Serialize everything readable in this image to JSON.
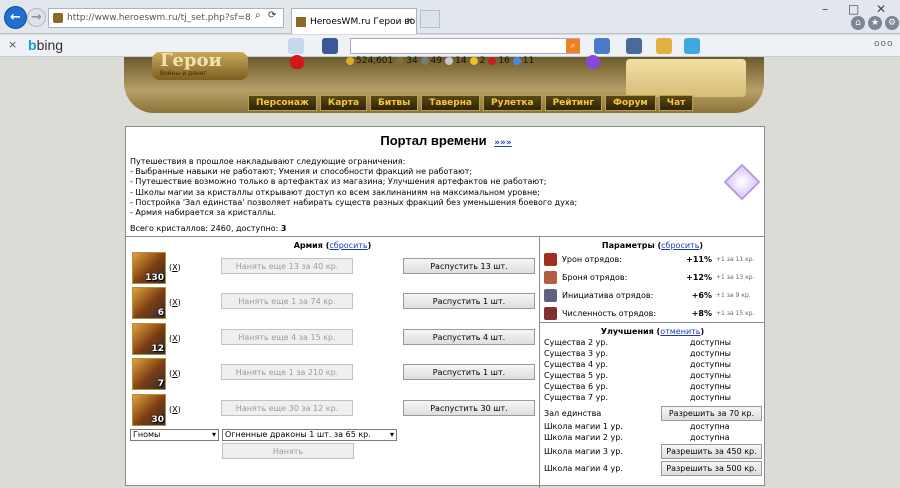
{
  "browser": {
    "url": "http://www.heroeswm.ru/tj_set.php?sf=8",
    "tab_title": "HeroesWM.ru Герои войн...",
    "search_engine": "bing",
    "back_glyph": "←",
    "forward_glyph": "→",
    "close_glyph": "×"
  },
  "resources": [
    {
      "value": "524,601",
      "color": "#e0b020"
    },
    {
      "value": "34",
      "color": "#8a6a3a"
    },
    {
      "value": "49",
      "color": "#7a7a7a"
    },
    {
      "value": "14",
      "color": "#c8c8c8"
    },
    {
      "value": "2",
      "color": "#e8c020"
    },
    {
      "value": "16",
      "color": "#c82020"
    },
    {
      "value": "11",
      "color": "#4a8ae0"
    }
  ],
  "header": {
    "logo": "Герои",
    "logo_sub": "Войны и денег"
  },
  "menu": [
    "Персонаж",
    "Карта",
    "Битвы",
    "Таверна",
    "Рулетка",
    "Рейтинг",
    "Форум",
    "Чат"
  ],
  "portal": {
    "title": "Портал времени",
    "more_link": "»»»",
    "restrictions": [
      "Путешествия в прошлое накладывают следующие ограничения:",
      "- Выбранные навыки не работают; Умения и способности фракций не работают;",
      "- Путешествие возможно только в артефактах из магазина; Улучшения артефактов не работают;",
      "- Школы магии за кристаллы открывают доступ ко всем заклинаниям на максимальном уровне;",
      "- Постройка 'Зал единства' позволяет набирать существ разных фракций без уменьшения боевого духа;",
      "- Армия набирается за кристаллы."
    ],
    "crystals_label": "Всего кристаллов: 2460, доступно:",
    "crystals_available": "3"
  },
  "army": {
    "title": "Армия",
    "reset": "сбросить",
    "remove_label": "X",
    "units": [
      {
        "count": "130",
        "hire": "Нанять еще 13 за 40 кр.",
        "dismiss": "Распустить 13 шт."
      },
      {
        "count": "6",
        "hire": "Нанять еще 1 за 74 кр.",
        "dismiss": "Распустить 1 шт."
      },
      {
        "count": "12",
        "hire": "Нанять еще 4 за 15 кр.",
        "dismiss": "Распустить 4 шт."
      },
      {
        "count": "7",
        "hire": "Нанять еще 1 за 210 кр.",
        "dismiss": "Распустить 1 шт."
      },
      {
        "count": "30",
        "hire": "Нанять еще 30 за 12 кр.",
        "dismiss": "Распустить 30 шт."
      }
    ],
    "race_select": "Гномы",
    "unit_select": "Огненные драконы 1 шт. за 65 кр.",
    "hire_button": "Нанять"
  },
  "params": {
    "title": "Параметры",
    "reset": "сбросить",
    "rows": [
      {
        "label": "Урон отрядов:",
        "value": "+11%",
        "note": "+1 за 11 кр.",
        "color": "#a03020"
      },
      {
        "label": "Броня отрядов:",
        "value": "+12%",
        "note": "+1 за 13 кр.",
        "color": "#b06040"
      },
      {
        "label": "Инициатива отрядов:",
        "value": "+6%",
        "note": "+1 за 9 кр.",
        "color": "#606080"
      },
      {
        "label": "Численность отрядов:",
        "value": "+8%",
        "note": "+1 за 15 кр.",
        "color": "#803030"
      }
    ]
  },
  "upgrades": {
    "title": "Улучшения",
    "cancel": "отменить",
    "rows": [
      {
        "name": "Существа 2 ур.",
        "status": "доступны"
      },
      {
        "name": "Существа 3 ур.",
        "status": "доступны"
      },
      {
        "name": "Существа 4 ур.",
        "status": "доступны"
      },
      {
        "name": "Существа 5 ур.",
        "status": "доступны"
      },
      {
        "name": "Существа 6 ур.",
        "status": "доступны"
      },
      {
        "name": "Существа 7 ур.",
        "status": "доступны"
      }
    ],
    "unity": {
      "name": "Зал единства",
      "button": "Разрешить за 70 кр."
    },
    "schools": [
      {
        "name": "Школа магии 1 ур.",
        "status": "доступна"
      },
      {
        "name": "Школа магии 2 ур.",
        "status": "доступна"
      }
    ],
    "school3": {
      "name": "Школа магии 3 ур.",
      "button": "Разрешить за 450 кр."
    },
    "school4": {
      "name": "Школа магии 4 ур.",
      "button": "Разрешить за 500 кр."
    }
  }
}
